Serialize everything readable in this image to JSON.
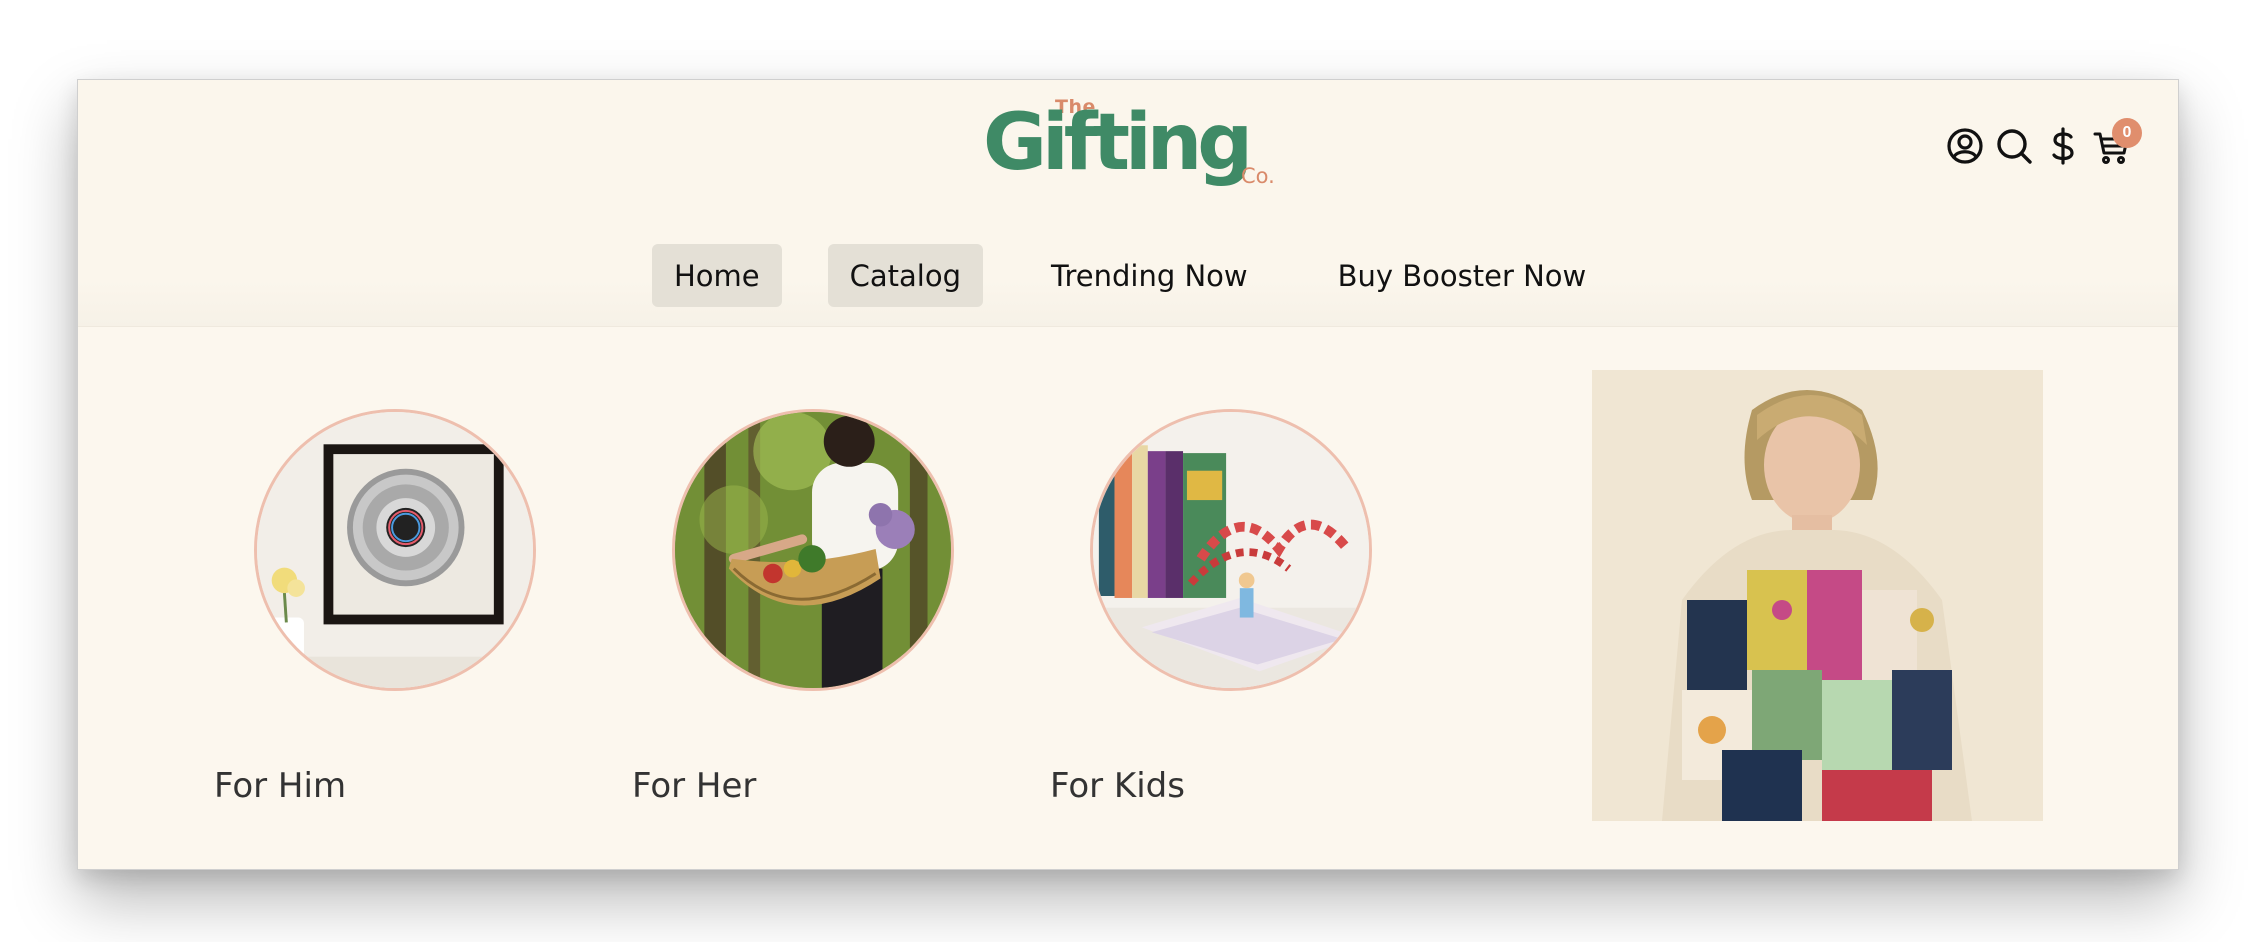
{
  "brand": {
    "the": "The",
    "name": "Gifting",
    "co": "Co."
  },
  "header_icons": [
    "account-icon",
    "search-icon",
    "currency-icon",
    "cart-icon"
  ],
  "cart": {
    "count": "0"
  },
  "nav": {
    "items": [
      {
        "label": "Home",
        "active": true
      },
      {
        "label": "Catalog",
        "active": true
      },
      {
        "label": "Trending Now",
        "active": false
      },
      {
        "label": "Buy Booster Now",
        "active": false
      }
    ]
  },
  "categories": [
    {
      "label": "For Him"
    },
    {
      "label": "For Her"
    },
    {
      "label": "For Kids"
    }
  ],
  "colors": {
    "background": "#fcf7ee",
    "brand_green": "#3f8a66",
    "brand_accent": "#d98a6a",
    "nav_active": "#e4e0d6",
    "badge": "#e08e6d",
    "circle_border": "#eebfae"
  }
}
